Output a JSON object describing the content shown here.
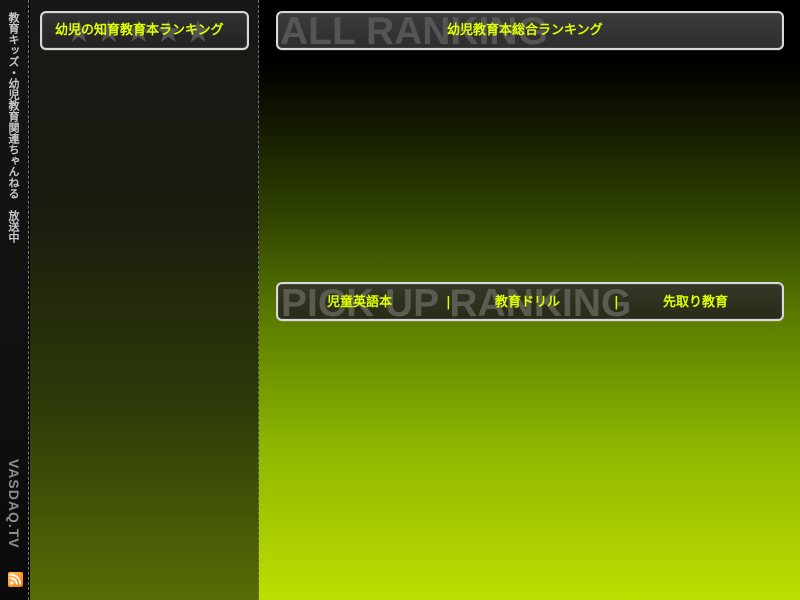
{
  "left_rail": {
    "vertical_title": "教育キッズ・幼児教育関連ちゃんねる　放送中",
    "brand_text": "VASDAQ.TV",
    "rss_icon": "rss-icon",
    "rss_color": "#ff9b28"
  },
  "side_panel": {
    "header_label": "幼児の知育教育本ランキング",
    "decorative_stars": "★★★★★"
  },
  "main_panel": {
    "all_ranking_watermark": "ALL RANKING",
    "all_ranking_label": "幼児教育本総合ランキング",
    "pickup_watermark": "PICK UP RANKING",
    "pickup_links": [
      "児童英語本",
      "教育ドリル",
      "先取り教育"
    ],
    "separator": "|"
  },
  "colors": {
    "accent_text": "#dfff00",
    "green_gradient_bottom": "#bddf00",
    "panel_border": "#d8d8d8"
  }
}
